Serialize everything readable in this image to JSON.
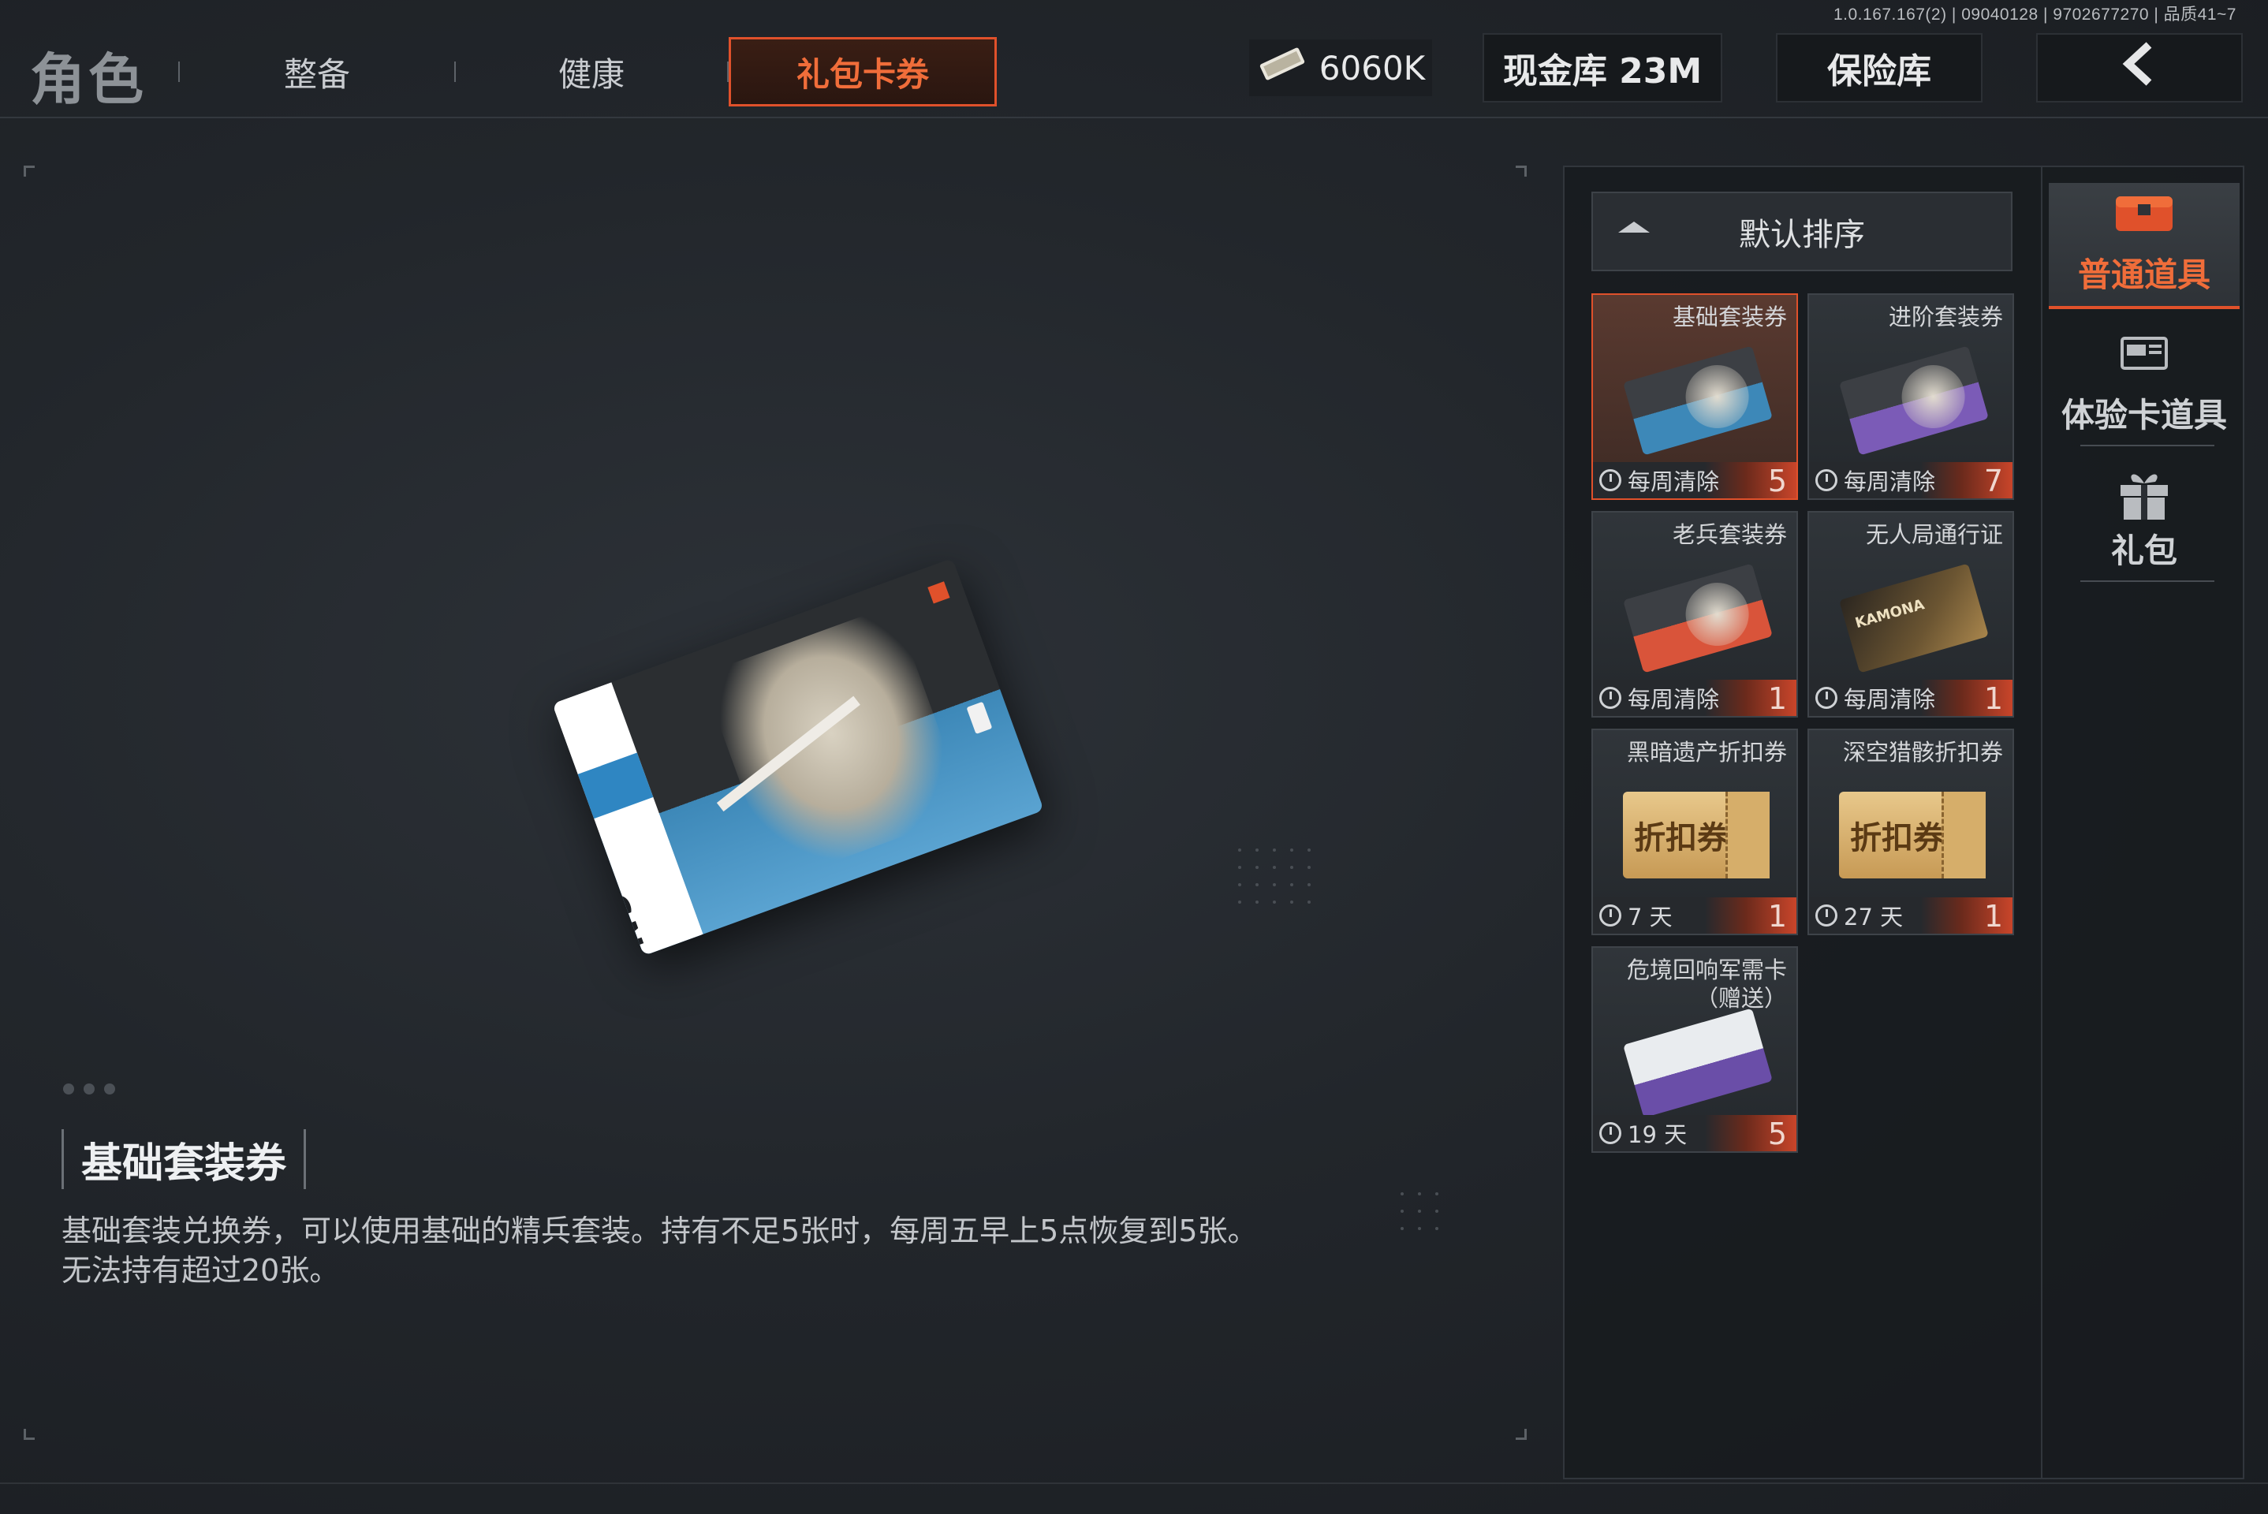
{
  "build_info": "1.0.167.167(2) | 09040128 | 9702677270 | 品质41~7",
  "header": {
    "title": "角色",
    "tabs": [
      {
        "label": "整备",
        "active": false
      },
      {
        "label": "健康",
        "active": false
      },
      {
        "label": "礼包卡券",
        "active": true
      }
    ],
    "currency_value": "6060K",
    "cash_vault": "现金库 23M",
    "safe_box": "保险库",
    "back_icon": "chevron-left-icon"
  },
  "preview": {
    "card_code": "CN617",
    "item_name": "基础套装券",
    "description": "基础套装兑换券，可以使用基础的精兵套装。持有不足5张时，每周五早上5点恢复到5张。无法持有超过20张。"
  },
  "inventory": {
    "sort_label": "默认排序",
    "items": [
      {
        "name": "基础套装券",
        "expiry": "每周清除",
        "count": "5",
        "selected": true
      },
      {
        "name": "进阶套装券",
        "expiry": "每周清除",
        "count": "7",
        "selected": false
      },
      {
        "name": "老兵套装券",
        "expiry": "每周清除",
        "count": "1",
        "selected": false
      },
      {
        "name": "无人局通行证",
        "expiry": "每周清除",
        "count": "1",
        "selected": false
      },
      {
        "name": "黑暗遗产折扣券",
        "expiry": "7 天",
        "count": "1",
        "selected": false
      },
      {
        "name": "深空猎骸折扣券",
        "expiry": "27 天",
        "count": "1",
        "selected": false
      },
      {
        "name": "危境回响军需卡\n（赠送）",
        "expiry": "19 天",
        "count": "5",
        "selected": false
      }
    ],
    "coupon_text": "折扣券",
    "pass_text": "KAMONA"
  },
  "categories": [
    {
      "label": "普通道具",
      "icon": "chest-icon",
      "active": true
    },
    {
      "label": "体验卡道具",
      "icon": "card-icon",
      "active": false
    },
    {
      "label": "礼包",
      "icon": "gift-icon",
      "active": false
    }
  ],
  "colors": {
    "accent": "#e0512b",
    "accent_text": "#f06d3a",
    "background": "#22262b"
  }
}
